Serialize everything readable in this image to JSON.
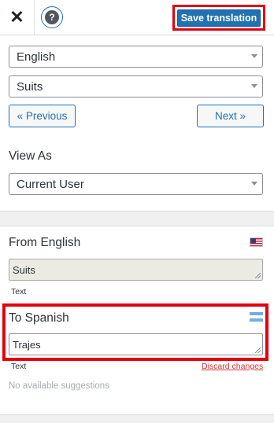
{
  "toolbar": {
    "close_glyph": "✕",
    "help_glyph": "?",
    "save_label": "Save translation"
  },
  "selectors": {
    "language": "English",
    "string": "Suits",
    "view_as": "Current User"
  },
  "navigation": {
    "previous_label": "« Previous",
    "next_label": "Next »"
  },
  "view_as_label": "View As",
  "source": {
    "title": "From English",
    "value": "Suits",
    "type_label": "Text",
    "flag_icon": "us-flag-icon"
  },
  "target": {
    "title": "To Spanish",
    "value": "Trajes",
    "type_label": "Text",
    "discard_label": "Discard changes",
    "flag_icon": "argentina-flag-icon"
  },
  "suggestions_text": "No available suggestions",
  "colors": {
    "accent": "#2271b1",
    "highlight_frame": "#e3000f",
    "discard_link": "#d63638"
  }
}
